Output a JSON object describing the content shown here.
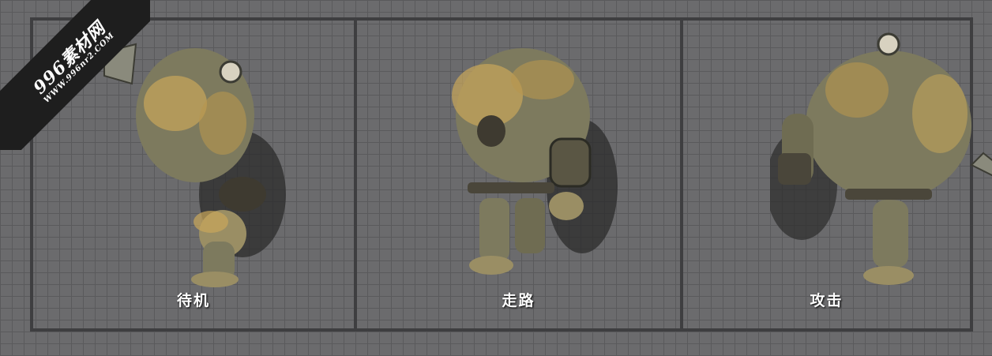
{
  "watermark": {
    "title": "996素材网",
    "url": "WWW.996nr2.COM"
  },
  "panels": [
    {
      "label": "待机",
      "pose": "idle"
    },
    {
      "label": "走路",
      "pose": "walk"
    },
    {
      "label": "攻击",
      "pose": "attack"
    }
  ],
  "colors": {
    "background": "#6b6b6d",
    "grid": "#5a5a5c",
    "frame": "#3e3e40",
    "skin": "#7d7a5e",
    "skin_highlight": "#c9a75a",
    "shadow": "#2b2b2b"
  }
}
